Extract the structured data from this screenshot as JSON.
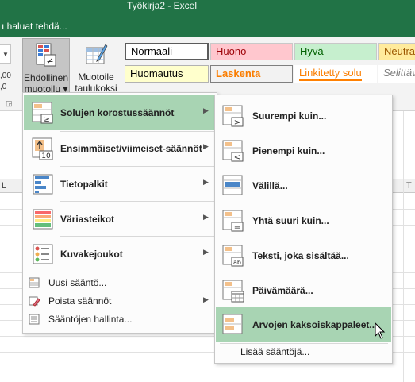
{
  "window": {
    "title": "Työkirja2 - Excel"
  },
  "tell_me": {
    "text": "ı haluat tehdä..."
  },
  "ribbon": {
    "left_numbers": [
      ",00",
      ",0"
    ],
    "conditional_formatting": {
      "line1": "Ehdollinen",
      "line2": "muotoilu ▾"
    },
    "format_as_table": {
      "line1": "Muotoile",
      "line2": "taulukoksi ▾"
    },
    "styles": [
      {
        "label": "Normaali"
      },
      {
        "label": "Huono"
      },
      {
        "label": "Hyvä"
      },
      {
        "label": "Neutraali"
      },
      {
        "label": "Huomautus"
      },
      {
        "label": "Laskenta"
      },
      {
        "label": "Linkitetty solu"
      },
      {
        "label": "Selittävä"
      }
    ]
  },
  "grid": {
    "column_headers": [
      "L",
      "T"
    ]
  },
  "main_menu": {
    "items": [
      {
        "label": "Solujen korostussäännöt",
        "icon": "highlight-cells-icon",
        "has_submenu": true,
        "active": true
      },
      {
        "label": "Ensimmäiset/viimeiset-säännöt",
        "icon": "top-bottom-icon",
        "has_submenu": true
      },
      {
        "label": "Tietopalkit",
        "icon": "data-bars-icon",
        "has_submenu": true
      },
      {
        "label": "Väriasteikot",
        "icon": "color-scales-icon",
        "has_submenu": true
      },
      {
        "label": "Kuvakejoukot",
        "icon": "icon-sets-icon",
        "has_submenu": true
      }
    ],
    "small_items": [
      {
        "label": "Uusi sääntö...",
        "icon": "new-rule-icon"
      },
      {
        "label": "Poista säännöt",
        "icon": "clear-rules-icon",
        "has_submenu": true
      },
      {
        "label": "Sääntöjen hallinta...",
        "icon": "manage-rules-icon"
      }
    ]
  },
  "submenu": {
    "items": [
      {
        "label": "Suurempi kuin...",
        "icon": "greater-than-icon"
      },
      {
        "label": "Pienempi kuin...",
        "icon": "less-than-icon"
      },
      {
        "label": "Välillä...",
        "icon": "between-icon"
      },
      {
        "label": "Yhtä suuri kuin...",
        "icon": "equal-to-icon"
      },
      {
        "label": "Teksti, joka sisältää...",
        "icon": "text-contains-icon"
      },
      {
        "label": "Päivämäärä...",
        "icon": "date-occurring-icon"
      },
      {
        "label": "Arvojen kaksoiskappaleet...",
        "icon": "duplicate-values-icon",
        "active": true
      }
    ],
    "more": "Lisää sääntöjä..."
  },
  "colors": {
    "excel_green": "#217346",
    "menu_hover": "#a8d4b3"
  }
}
